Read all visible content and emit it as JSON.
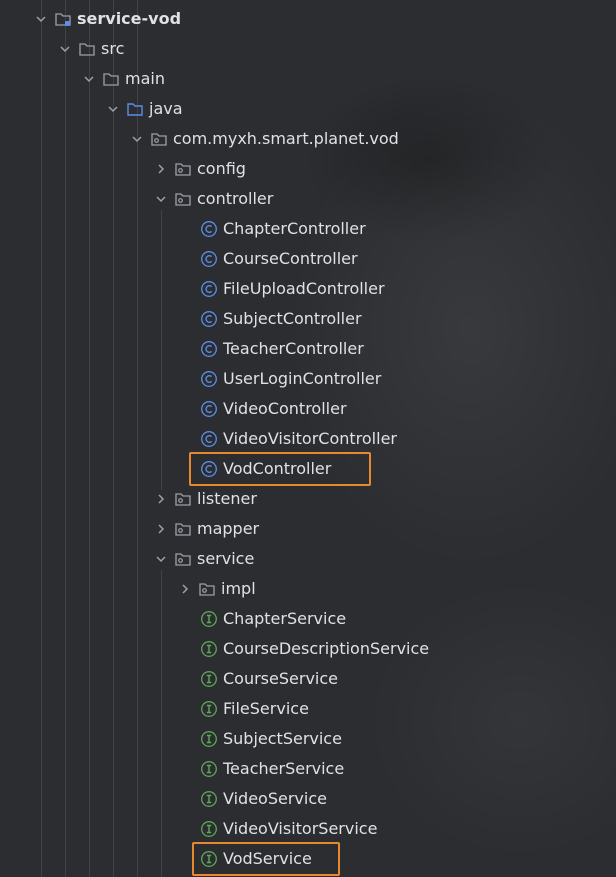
{
  "project_tree": {
    "module": {
      "label": "service-vod"
    },
    "src": {
      "label": "src"
    },
    "main": {
      "label": "main"
    },
    "java": {
      "label": "java"
    },
    "package": {
      "label": "com.myxh.smart.planet.vod"
    },
    "config": {
      "label": "config"
    },
    "controller": {
      "label": "controller",
      "items": [
        "ChapterController",
        "CourseController",
        "FileUploadController",
        "SubjectController",
        "TeacherController",
        "UserLoginController",
        "VideoController",
        "VideoVisitorController",
        "VodController"
      ]
    },
    "listener": {
      "label": "listener"
    },
    "mapper": {
      "label": "mapper"
    },
    "service": {
      "label": "service",
      "impl_label": "impl",
      "items": [
        "ChapterService",
        "CourseDescriptionService",
        "CourseService",
        "FileService",
        "SubjectService",
        "TeacherService",
        "VideoService",
        "VideoVisitorService",
        "VodService"
      ]
    }
  },
  "colors": {
    "background": "#2b2d30",
    "text": "#dfe1e5",
    "class_icon": "#5c8ee6",
    "interface_icon": "#5fa55a",
    "folder_icon": "#9da0a8",
    "source_folder_icon": "#5c8ee6",
    "highlight": "#e8892f"
  },
  "highlighted_items": [
    "VodController",
    "VodService"
  ]
}
